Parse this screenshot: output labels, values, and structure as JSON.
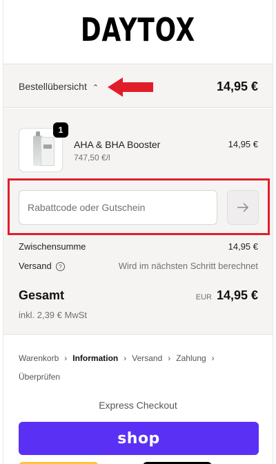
{
  "header": {
    "logo_text": "DAYTOX"
  },
  "summary": {
    "toggle_label": "Bestellübersicht",
    "total": "14,95 €"
  },
  "product": {
    "quantity": "1",
    "name": "AHA & BHA Booster",
    "unit_price": "747,50 €/l",
    "price": "14,95 €"
  },
  "discount": {
    "placeholder": "Rabattcode oder Gutschein"
  },
  "totals": {
    "subtotal_label": "Zwischensumme",
    "subtotal_value": "14,95 €",
    "shipping_label": "Versand",
    "shipping_value": "Wird im nächsten Schritt berechnet",
    "total_label": "Gesamt",
    "currency": "EUR",
    "total_value": "14,95 €",
    "tax_note": "inkl. 2,39 € MwSt"
  },
  "breadcrumb": [
    "Warenkorb",
    "Information",
    "Versand",
    "Zahlung",
    "Überprüfen"
  ],
  "breadcrumb_active": "Information",
  "express": {
    "label": "Express Checkout",
    "shop_button": "shop"
  },
  "colors": {
    "shop_purple": "#5a31f4",
    "annotation_red": "#e21d2a",
    "summary_bg": "#f5f4f2"
  }
}
